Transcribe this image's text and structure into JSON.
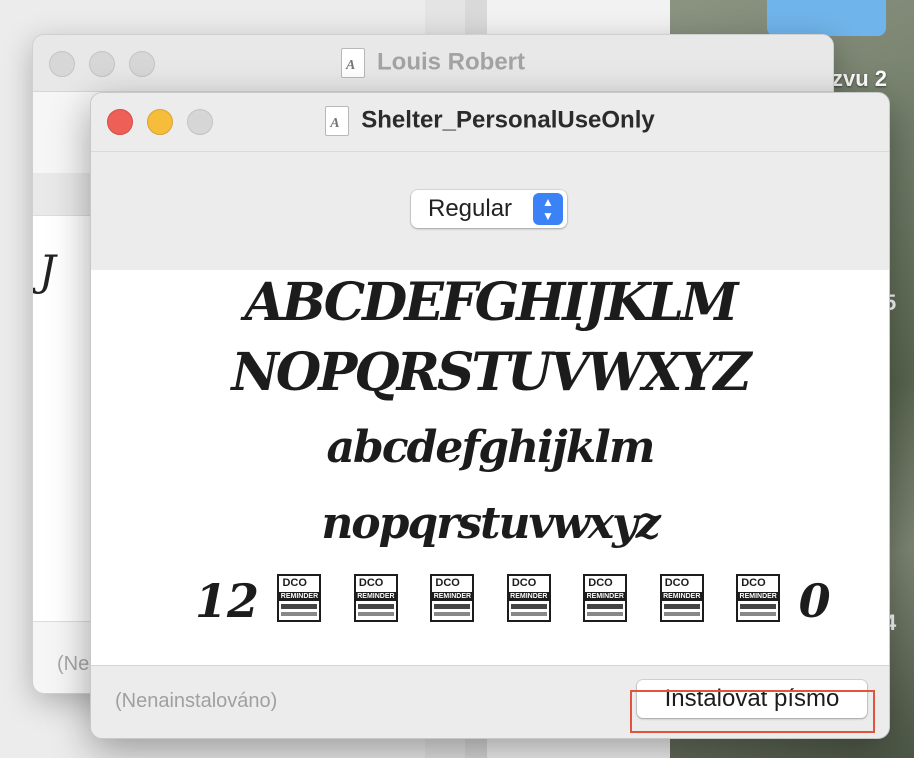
{
  "desktop": {
    "label_partial": "zvu 2",
    "num1": "5",
    "num2": "4"
  },
  "back_window": {
    "title": "Louis Robert",
    "footer_status": "(Ne",
    "preview_glyph": "J"
  },
  "front_window": {
    "title": "Shelter_PersonalUseOnly",
    "doc_icon_glyph": "A",
    "style_select": {
      "value": "Regular",
      "stepper": "⌃⌄"
    },
    "sample": {
      "line1": "ABCDEFGHIJKLM",
      "line2": "NOPQRSTUVWXYZ",
      "line3": "abcdefghijklm",
      "line4": "nopqrstuvwxyz",
      "digit_first": "12",
      "digit_last": "0",
      "placeholder_badge": {
        "brand": "DCO",
        "title": "REMINDER",
        "subtitle": "PERSONAL USE ONLY"
      }
    },
    "footer": {
      "status": "(Nenainstalováno)",
      "install_button": "Instalovat písmo"
    }
  },
  "colors": {
    "close": "#ee5f57",
    "minimize": "#f6bd3b",
    "accent": "#3b82f7",
    "highlight": "#e2533e"
  }
}
